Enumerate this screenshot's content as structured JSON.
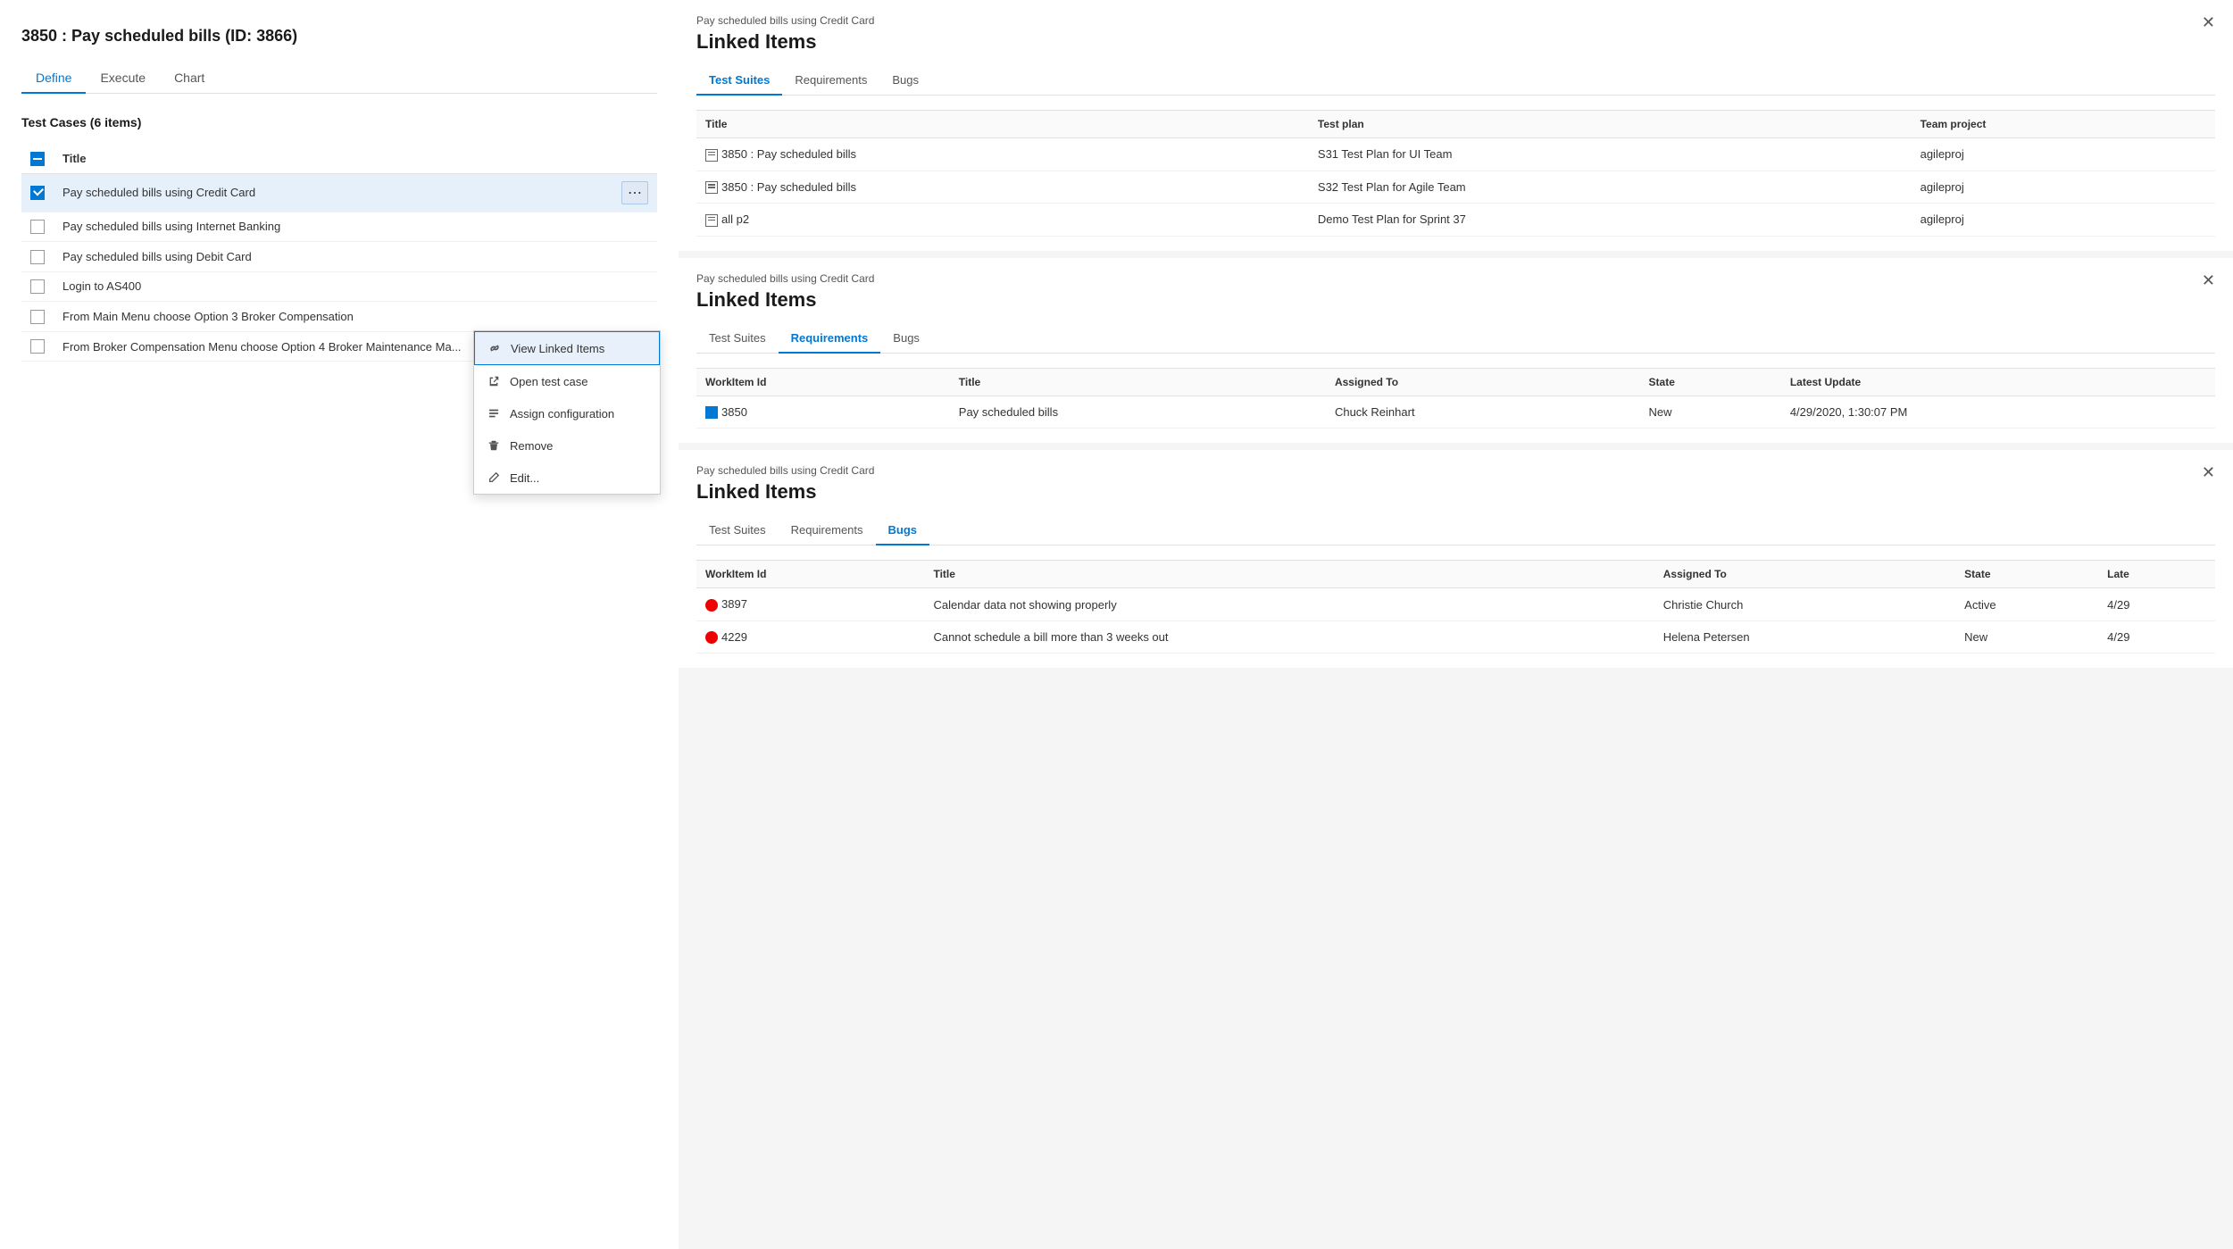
{
  "leftPanel": {
    "pageTitle": "3850 : Pay scheduled bills (ID: 3866)",
    "tabs": [
      {
        "label": "Define",
        "active": true
      },
      {
        "label": "Execute",
        "active": false
      },
      {
        "label": "Chart",
        "active": false
      }
    ],
    "sectionTitle": "Test Cases (6 items)",
    "tableHeader": "Title",
    "testCases": [
      {
        "id": 1,
        "title": "Pay scheduled bills using Credit Card",
        "checked": true,
        "selected": true
      },
      {
        "id": 2,
        "title": "Pay scheduled bills using Internet Banking",
        "checked": false,
        "selected": false
      },
      {
        "id": 3,
        "title": "Pay scheduled bills using Debit Card",
        "checked": false,
        "selected": false
      },
      {
        "id": 4,
        "title": "Login to AS400",
        "checked": false,
        "selected": false
      },
      {
        "id": 5,
        "title": "From Main Menu choose Option 3 Broker Compensation",
        "checked": false,
        "selected": false
      },
      {
        "id": 6,
        "title": "From Broker Compensation Menu choose Option 4 Broker Maintenance Ma...",
        "checked": false,
        "selected": false
      }
    ],
    "contextMenu": {
      "items": [
        {
          "label": "View Linked Items",
          "icon": "link",
          "highlighted": true
        },
        {
          "label": "Open test case",
          "icon": "arrow-up-right"
        },
        {
          "label": "Assign configuration",
          "icon": "list"
        },
        {
          "label": "Remove",
          "icon": "trash"
        },
        {
          "label": "Edit...",
          "icon": "pencil"
        }
      ]
    }
  },
  "rightPanel": {
    "cards": [
      {
        "subtitle": "Pay scheduled bills using Credit Card",
        "title": "Linked Items",
        "activeTab": "Test Suites",
        "tabs": [
          "Test Suites",
          "Requirements",
          "Bugs"
        ],
        "columns": [
          "Title",
          "Test plan",
          "Team project"
        ],
        "rows": [
          {
            "icon": "suite",
            "col1": "3850 : Pay scheduled bills",
            "col2": "S31 Test Plan for UI Team",
            "col3": "agileproj"
          },
          {
            "icon": "suite",
            "col1": "3850 : Pay scheduled bills",
            "col2": "S32 Test Plan for Agile Team",
            "col3": "agileproj"
          },
          {
            "icon": "suite",
            "col1": "all p2",
            "col2": "Demo Test Plan for Sprint 37",
            "col3": "agileproj"
          }
        ]
      },
      {
        "subtitle": "Pay scheduled bills using Credit Card",
        "title": "Linked Items",
        "activeTab": "Requirements",
        "tabs": [
          "Test Suites",
          "Requirements",
          "Bugs"
        ],
        "columns": [
          "WorkItem Id",
          "Title",
          "Assigned To",
          "State",
          "Latest Update"
        ],
        "rows": [
          {
            "icon": "workitem",
            "col1": "3850",
            "col2": "Pay scheduled bills",
            "col3": "Chuck Reinhart",
            "col4": "New",
            "col5": "4/29/2020, 1:30:07 PM"
          }
        ]
      },
      {
        "subtitle": "Pay scheduled bills using Credit Card",
        "title": "Linked Items",
        "activeTab": "Bugs",
        "tabs": [
          "Test Suites",
          "Requirements",
          "Bugs"
        ],
        "columns": [
          "WorkItem Id",
          "Title",
          "Assigned To",
          "State",
          "Late"
        ],
        "rows": [
          {
            "icon": "bug",
            "col1": "3897",
            "col2": "Calendar data not showing properly",
            "col3": "Christie Church",
            "col4": "Active",
            "col5": "4/29"
          },
          {
            "icon": "bug",
            "col1": "4229",
            "col2": "Cannot schedule a bill more than 3 weeks out",
            "col3": "Helena Petersen",
            "col4": "New",
            "col5": "4/29"
          }
        ]
      }
    ]
  }
}
